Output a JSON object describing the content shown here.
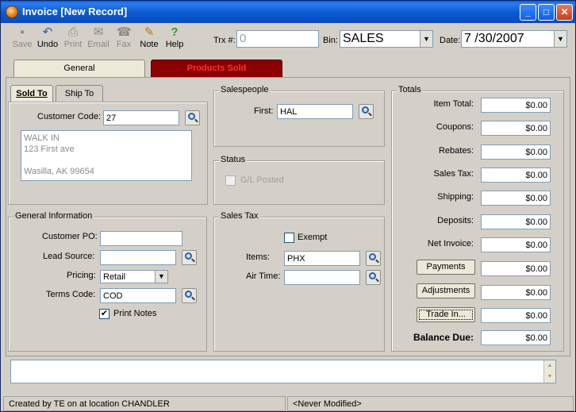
{
  "window": {
    "title": "Invoice [New Record]"
  },
  "toolbar": {
    "save": "Save",
    "undo": "Undo",
    "print": "Print",
    "email": "Email",
    "fax": "Fax",
    "note": "Note",
    "help": "Help"
  },
  "header": {
    "trx_label": "Trx #:",
    "trx_value": "0",
    "bin_label": "Bin:",
    "bin_value": "SALES",
    "date_label": "Date:",
    "date_value": "7 /30/2007"
  },
  "tabs": {
    "general": "General",
    "products_sold": "Products Sold"
  },
  "subtabs": {
    "sold_to": "Sold To",
    "ship_to": "Ship To"
  },
  "sold_to": {
    "customer_code_label": "Customer Code:",
    "customer_code_value": "27",
    "address_lines": [
      "WALK IN",
      "123 First ave",
      "",
      "Wasilla, AK 99654"
    ]
  },
  "general_info": {
    "title": "General Information",
    "customer_po_label": "Customer PO:",
    "customer_po_value": "",
    "lead_source_label": "Lead Source:",
    "lead_source_value": "",
    "pricing_label": "Pricing:",
    "pricing_value": "Retail",
    "terms_code_label": "Terms Code:",
    "terms_code_value": "COD",
    "print_notes_label": "Print Notes",
    "print_notes_checked": "✔"
  },
  "salespeople": {
    "title": "Salespeople",
    "first_label": "First:",
    "first_value": "HAL"
  },
  "status": {
    "title": "Status",
    "gl_posted_label": "G/L Posted"
  },
  "sales_tax": {
    "title": "Sales Tax",
    "exempt_label": "Exempt",
    "items_label": "Items:",
    "items_value": "PHX",
    "air_time_label": "Air Time:",
    "air_time_value": ""
  },
  "totals": {
    "title": "Totals",
    "item_total_label": "Item Total:",
    "item_total": "$0.00",
    "coupons_label": "Coupons:",
    "coupons": "$0.00",
    "rebates_label": "Rebates:",
    "rebates": "$0.00",
    "sales_tax_label": "Sales Tax:",
    "sales_tax": "$0.00",
    "shipping_label": "Shipping:",
    "shipping": "$0.00",
    "deposits_label": "Deposits:",
    "deposits": "$0.00",
    "net_invoice_label": "Net Invoice:",
    "net_invoice": "$0.00",
    "payments_button": "Payments",
    "payments": "$0.00",
    "adjustments_button": "Adjustments",
    "adjustments": "$0.00",
    "trade_in_button": "Trade In...",
    "trade_in": "$0.00",
    "balance_due_label": "Balance Due:",
    "balance_due": "$0.00"
  },
  "statusbar": {
    "created": "Created by TE on  at location CHANDLER",
    "modified": "<Never Modified>"
  }
}
